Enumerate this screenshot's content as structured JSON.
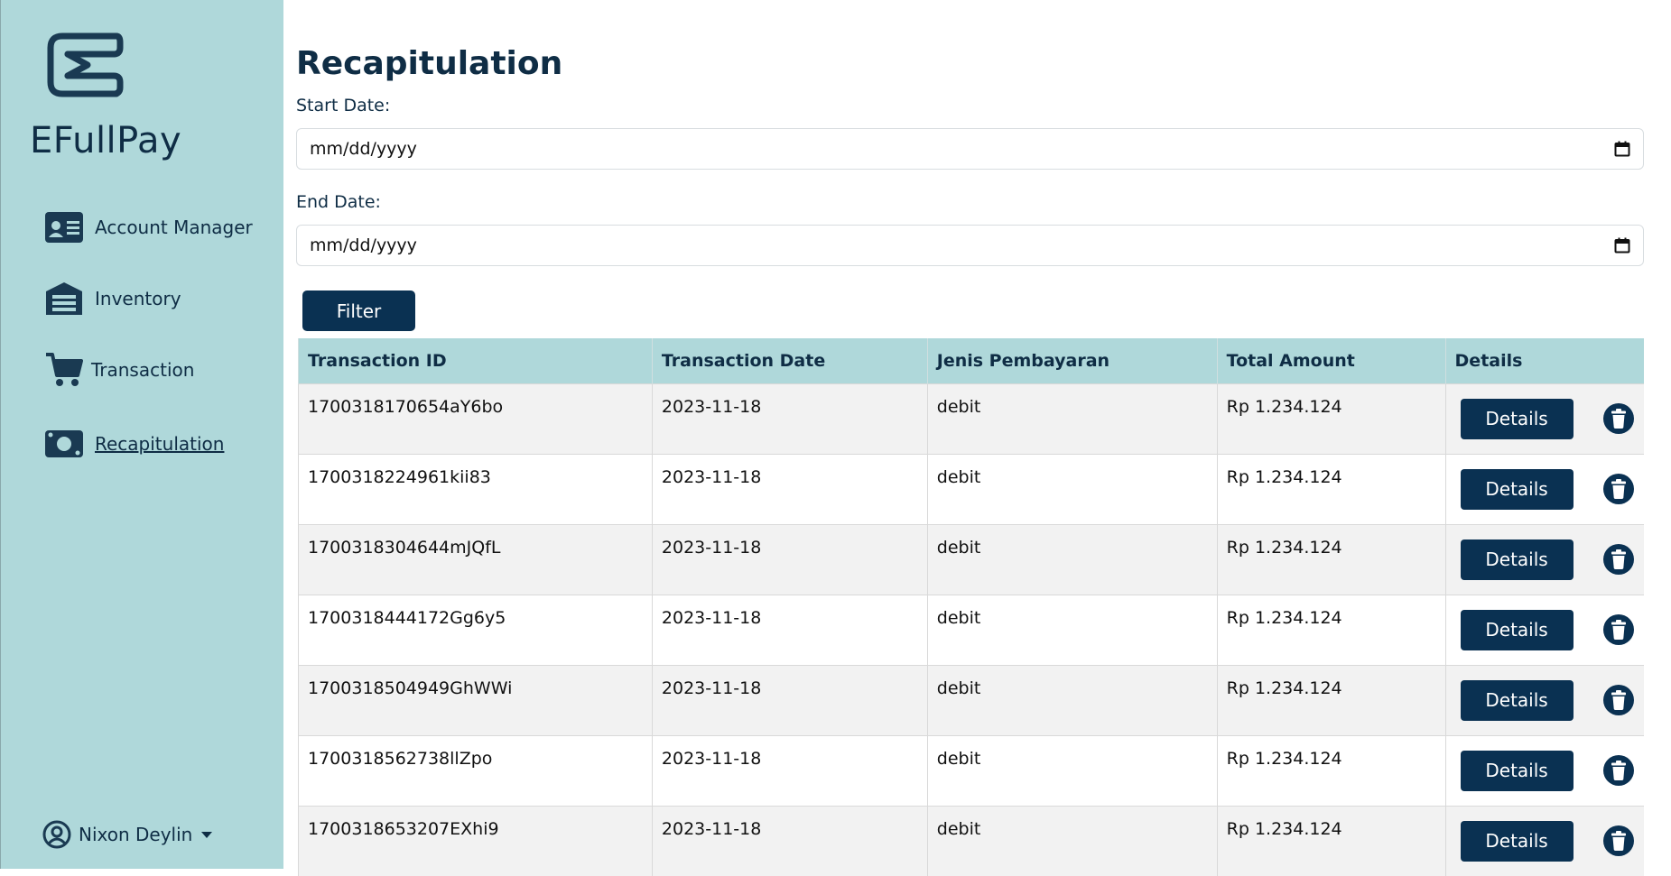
{
  "app": {
    "brand": "EFullPay",
    "logo_icon": "efullpay-logo-icon"
  },
  "sidebar": {
    "items": [
      {
        "label": "Account Manager",
        "icon": "id-card-icon",
        "active": false
      },
      {
        "label": "Inventory",
        "icon": "warehouse-icon",
        "active": false
      },
      {
        "label": "Transaction",
        "icon": "cart-icon",
        "active": false
      },
      {
        "label": "Recapitulation",
        "icon": "money-icon",
        "active": true
      }
    ],
    "user": {
      "name": "Nixon Deylin",
      "icon": "user-circle-icon"
    }
  },
  "main": {
    "title": "Recapitulation",
    "start_label": "Start Date:",
    "start_placeholder": "mm/dd/yyyy",
    "end_label": "End Date:",
    "end_placeholder": "mm/dd/yyyy",
    "filter_label": "Filter",
    "table": {
      "headers": [
        "Transaction ID",
        "Transaction Date",
        "Jenis Pembayaran",
        "Total Amount",
        "Details"
      ],
      "rows": [
        {
          "id": "1700318170654aY6bo",
          "date": "2023-11-18",
          "payment": "debit",
          "amount": "Rp 1.234.124",
          "details_label": "Details"
        },
        {
          "id": "1700318224961kii83",
          "date": "2023-11-18",
          "payment": "debit",
          "amount": "Rp 1.234.124",
          "details_label": "Details"
        },
        {
          "id": "1700318304644mJQfL",
          "date": "2023-11-18",
          "payment": "debit",
          "amount": "Rp 1.234.124",
          "details_label": "Details"
        },
        {
          "id": "1700318444172Gg6y5",
          "date": "2023-11-18",
          "payment": "debit",
          "amount": "Rp 1.234.124",
          "details_label": "Details"
        },
        {
          "id": "1700318504949GhWWi",
          "date": "2023-11-18",
          "payment": "debit",
          "amount": "Rp 1.234.124",
          "details_label": "Details"
        },
        {
          "id": "1700318562738llZpo",
          "date": "2023-11-18",
          "payment": "debit",
          "amount": "Rp 1.234.124",
          "details_label": "Details"
        },
        {
          "id": "1700318653207EXhi9",
          "date": "2023-11-18",
          "payment": "debit",
          "amount": "Rp 1.234.124",
          "details_label": "Details"
        }
      ]
    }
  },
  "colors": {
    "sidebar_bg": "#afd8da",
    "primary": "#0a3152",
    "text": "#0f2d45",
    "row_alt": "#f2f2f2"
  }
}
